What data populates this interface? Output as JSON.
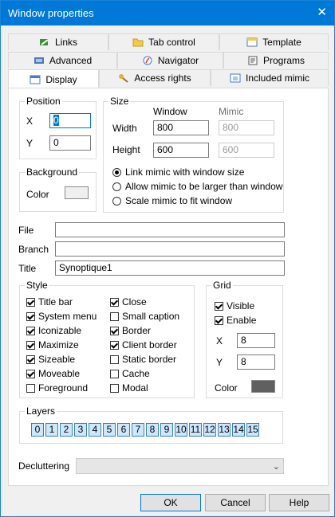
{
  "window": {
    "title": "Window properties",
    "close_glyph": "✕"
  },
  "tabs": {
    "row1": [
      {
        "label": "Links",
        "icon": "links-icon"
      },
      {
        "label": "Tab control",
        "icon": "folder-icon"
      },
      {
        "label": "Template",
        "icon": "template-icon"
      }
    ],
    "row2": [
      {
        "label": "Advanced",
        "icon": "advanced-icon"
      },
      {
        "label": "Navigator",
        "icon": "compass-icon"
      },
      {
        "label": "Programs",
        "icon": "programs-icon"
      }
    ],
    "row3": [
      {
        "label": "Display",
        "icon": "display-icon",
        "active": true
      },
      {
        "label": "Access rights",
        "icon": "keys-icon"
      },
      {
        "label": "Included mimic",
        "icon": "mimic-icon"
      }
    ]
  },
  "position": {
    "legend": "Position",
    "x_label": "X",
    "x_value": "0",
    "y_label": "Y",
    "y_value": "0"
  },
  "size": {
    "legend": "Size",
    "col_window": "Window",
    "col_mimic": "Mimic",
    "width_label": "Width",
    "width_window": "800",
    "width_mimic": "800",
    "height_label": "Height",
    "height_window": "600",
    "height_mimic": "600",
    "options": [
      {
        "label": "Link mimic with window size",
        "selected": true
      },
      {
        "label": "Allow mimic to be larger than window",
        "selected": false
      },
      {
        "label": "Scale mimic to fit window",
        "selected": false
      }
    ]
  },
  "background": {
    "legend": "Background",
    "color_label": "Color",
    "color": "#efefef"
  },
  "fields": {
    "file_label": "File",
    "file_value": "",
    "branch_label": "Branch",
    "branch_value": "",
    "title_label": "Title",
    "title_value": "Synoptique1"
  },
  "style": {
    "legend": "Style",
    "left": [
      {
        "label": "Title bar",
        "checked": true
      },
      {
        "label": "System menu",
        "checked": true
      },
      {
        "label": "Iconizable",
        "checked": true
      },
      {
        "label": "Maximize",
        "checked": true
      },
      {
        "label": "Sizeable",
        "checked": true
      },
      {
        "label": "Moveable",
        "checked": true
      },
      {
        "label": "Foreground",
        "checked": false
      }
    ],
    "right": [
      {
        "label": "Close",
        "checked": true
      },
      {
        "label": "Small caption",
        "checked": false
      },
      {
        "label": "Border",
        "checked": true
      },
      {
        "label": "Client border",
        "checked": true
      },
      {
        "label": "Static border",
        "checked": false
      },
      {
        "label": "Cache",
        "checked": false
      },
      {
        "label": "Modal",
        "checked": false
      }
    ]
  },
  "grid": {
    "legend": "Grid",
    "visible_label": "Visible",
    "visible": true,
    "enable_label": "Enable",
    "enable": true,
    "x_label": "X",
    "x_value": "8",
    "y_label": "Y",
    "y_value": "8",
    "color_label": "Color",
    "color": "#606060"
  },
  "layers": {
    "legend": "Layers",
    "items": [
      "0",
      "1",
      "2",
      "3",
      "4",
      "5",
      "6",
      "7",
      "8",
      "9",
      "10",
      "11",
      "12",
      "13",
      "14",
      "15"
    ]
  },
  "decluttering": {
    "label": "Decluttering",
    "value": ""
  },
  "buttons": {
    "ok": "OK",
    "cancel": "Cancel",
    "help": "Help"
  },
  "colors": {
    "titlebar": "#0078d7",
    "accent": "#0078d7",
    "layer_fill": "#cce8ff"
  }
}
